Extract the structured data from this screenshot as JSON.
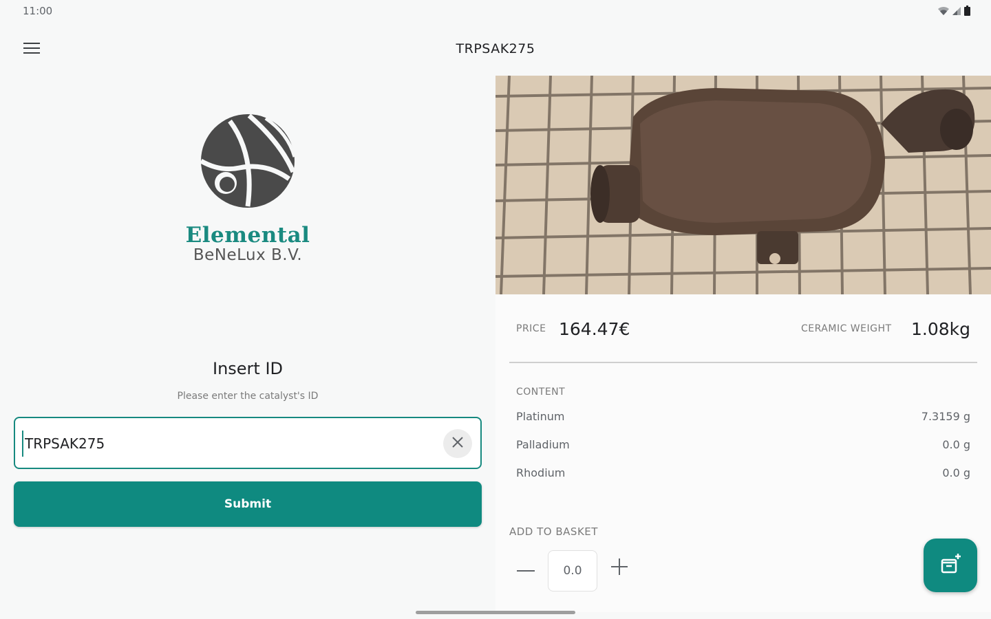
{
  "status_bar": {
    "time": "11:00"
  },
  "app_bar": {
    "title": "TRPSAK275"
  },
  "brand": {
    "name": "Elemental",
    "subtitle": "BeNeLux B.V."
  },
  "insert_form": {
    "title": "Insert ID",
    "hint": "Please enter the catalyst's ID",
    "id_value": "TRPSAK275",
    "submit_label": "Submit"
  },
  "details": {
    "price_label": "PRICE",
    "price_value": "164.47€",
    "weight_label": "CERAMIC WEIGHT",
    "weight_value": "1.08kg",
    "content_label": "CONTENT",
    "metals": [
      {
        "name": "Platinum",
        "value": "7.3159 g"
      },
      {
        "name": "Palladium",
        "value": "0.0 g"
      },
      {
        "name": "Rhodium",
        "value": "0.0 g"
      }
    ],
    "basket_label": "ADD TO BASKET",
    "quantity": "0.0"
  },
  "colors": {
    "accent": "#0f8a80",
    "brand_text": "#1a8a80"
  },
  "icons": [
    "menu-icon",
    "wifi-icon",
    "signal-icon",
    "battery-icon",
    "close-icon",
    "minus-icon",
    "plus-icon",
    "add-to-basket-icon"
  ]
}
